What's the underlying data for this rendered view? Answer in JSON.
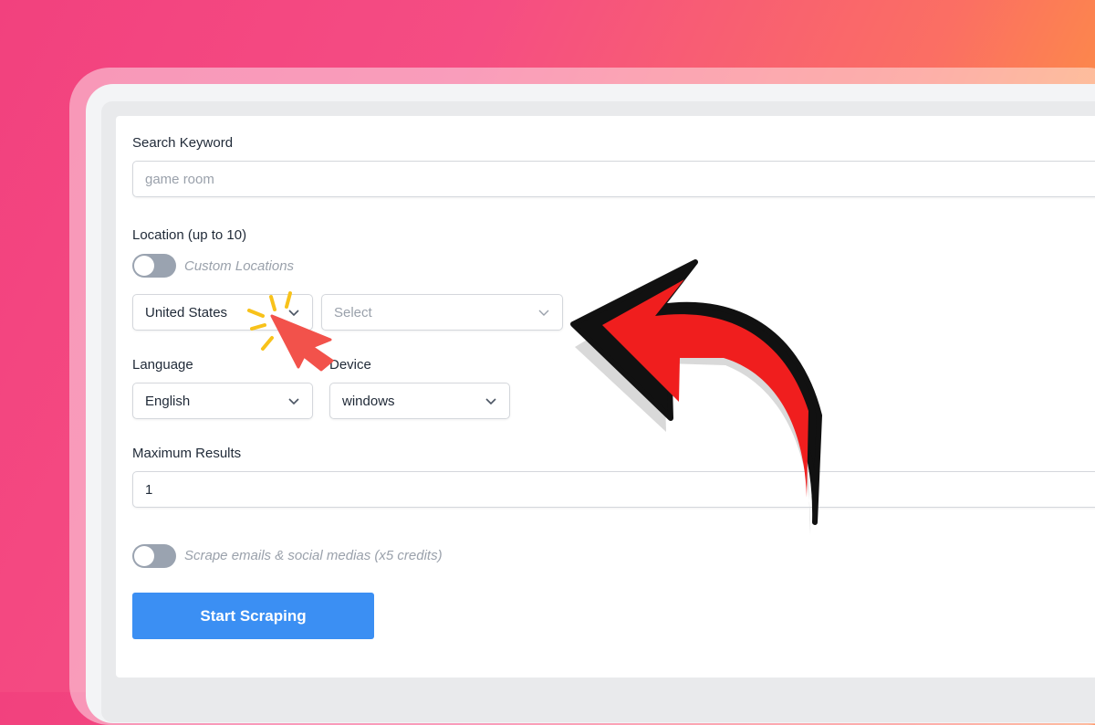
{
  "form": {
    "keyword": {
      "label": "Search Keyword",
      "placeholder": "game room"
    },
    "location": {
      "label": "Location (up to 10)",
      "custom_toggle_label": "Custom Locations",
      "country_value": "United States",
      "region_placeholder": "Select"
    },
    "language": {
      "label": "Language",
      "value": "English"
    },
    "device": {
      "label": "Device",
      "value": "windows"
    },
    "max_results": {
      "label": "Maximum Results",
      "value": "1"
    },
    "scrape_toggle_label": "Scrape emails & social medias (x5 credits)",
    "submit_label": "Start Scraping"
  },
  "icons": {
    "dropdown": "chevron-down-icon",
    "cursor": "click-cursor-icon",
    "annotation": "curved-arrow-icon"
  },
  "colors": {
    "primary_button": "#3b8ff3",
    "toggle_off": "#9aa3b0",
    "annotation_arrow": "#f01e1e",
    "click_rays": "#f8c21a",
    "cursor": "#f2524b"
  }
}
